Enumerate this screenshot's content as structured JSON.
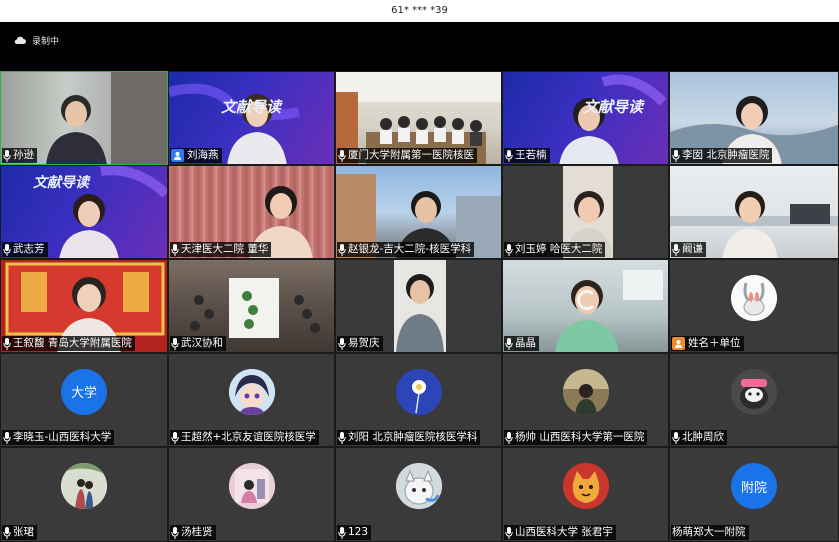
{
  "status_bar": {
    "phone_text": "61* *** *39"
  },
  "meeting": {
    "recording_label": "录制中"
  },
  "participants": [
    {
      "name": "孙逊",
      "label_icon": "mic-icon"
    },
    {
      "name": "刘海燕",
      "label_icon": "host-icon"
    },
    {
      "name": "厦门大学附属第一医院核医",
      "label_icon": "mic-icon"
    },
    {
      "name": "王若楠",
      "label_icon": "mic-icon"
    },
    {
      "name": "李囡 北京肿瘤医院",
      "label_icon": "mic-icon"
    },
    {
      "name": "武志芳",
      "label_icon": "mic-icon"
    },
    {
      "name": "天津医大二院 董华",
      "label_icon": "mic-icon"
    },
    {
      "name": "赵银龙-吉大二院-核医学科",
      "label_icon": "mic-icon"
    },
    {
      "name": "刘玉婷 哈医大二院",
      "label_icon": "mic-icon"
    },
    {
      "name": "阚谦",
      "label_icon": "mic-icon"
    },
    {
      "name": "王叙馥 青岛大学附属医院",
      "label_icon": "mic-icon"
    },
    {
      "name": "武汉协和",
      "label_icon": "mic-icon"
    },
    {
      "name": "易贺庆",
      "label_icon": "mic-icon"
    },
    {
      "name": "晶晶",
      "label_icon": "mic-icon"
    },
    {
      "name": "姓名＋单位",
      "label_icon": "host-icon"
    },
    {
      "name": "李晓玉-山西医科大学",
      "label_icon": "mic-icon",
      "avatar_text": "大学"
    },
    {
      "name": "王超然+北京友谊医院核医学",
      "label_icon": "mic-icon"
    },
    {
      "name": "刘阳 北京肿瘤医院核医学科",
      "label_icon": "mic-icon"
    },
    {
      "name": "杨帅 山西医科大学第一医院",
      "label_icon": "mic-icon"
    },
    {
      "name": "北肿周欣",
      "label_icon": "mic-icon"
    },
    {
      "name": "张珺",
      "label_icon": "mic-icon"
    },
    {
      "name": "汤桂贤",
      "label_icon": "mic-icon"
    },
    {
      "name": "123",
      "label_icon": "mic-icon"
    },
    {
      "name": "山西医科大学 张君宇",
      "label_icon": "mic-icon"
    },
    {
      "name": "杨萌郑大一附院",
      "label_icon": "none",
      "avatar_text": "附院"
    }
  ],
  "banners": {
    "title": "文献导读"
  },
  "colors": {
    "active_border": "#35b24a",
    "avatar_blue": "#1a73e8",
    "host_badge": "#2d7cf6",
    "host_badge_alt": "#f08a2c"
  }
}
